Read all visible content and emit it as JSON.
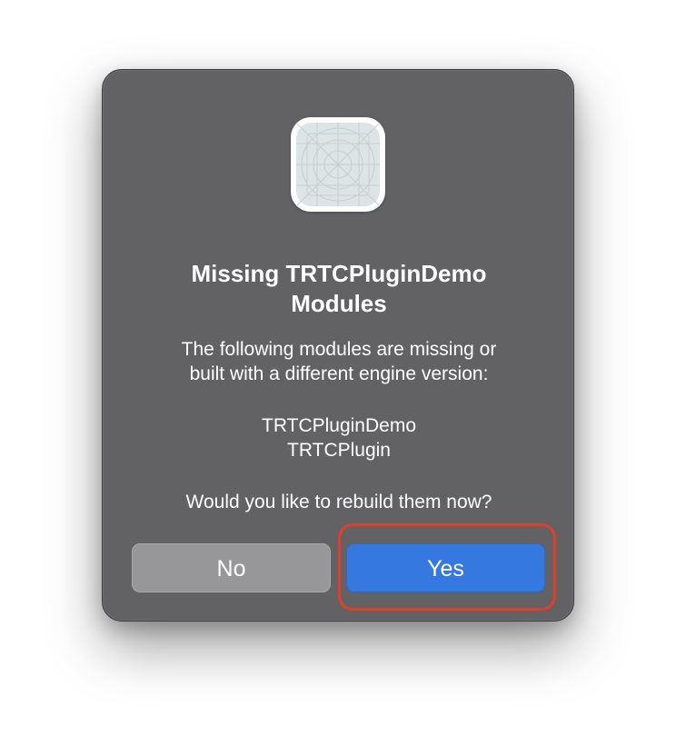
{
  "dialog": {
    "app_icon": "app-placeholder-icon",
    "title_line1": "Missing TRTCPluginDemo",
    "title_line2": "Modules",
    "message_line1": "The following modules are missing or",
    "message_line2": "built with a different engine version:",
    "modules": [
      "TRTCPluginDemo",
      "TRTCPlugin"
    ],
    "question": "Would you like to rebuild them now?",
    "buttons": {
      "no_label": "No",
      "yes_label": "Yes"
    }
  },
  "colors": {
    "dialog_background": "#626265",
    "no_button": "#97979a",
    "yes_button": "#3478e0",
    "highlight": "#e33d25"
  }
}
